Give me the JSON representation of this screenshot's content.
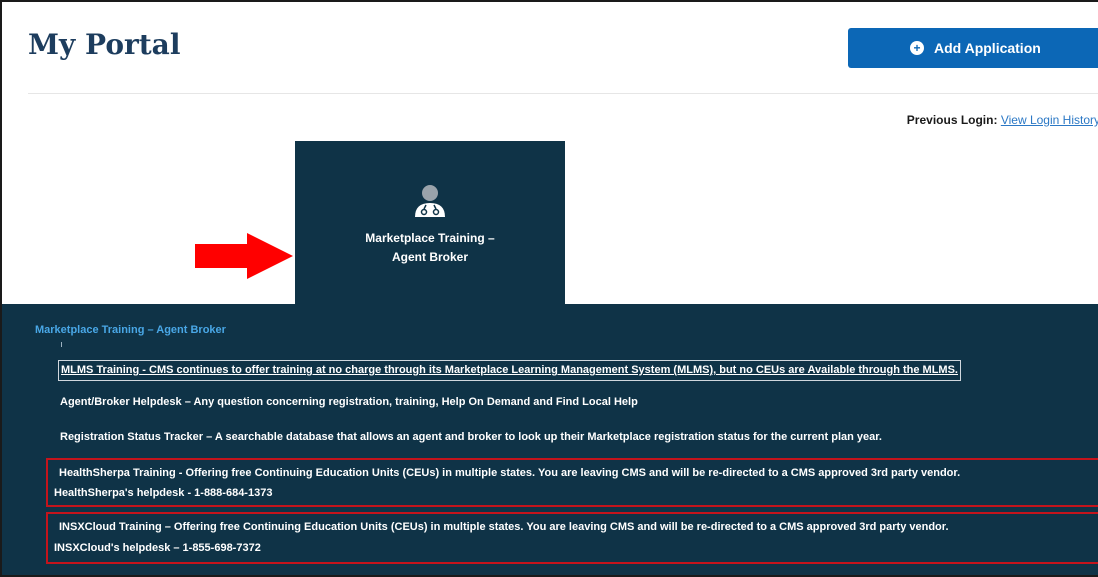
{
  "header": {
    "title": "My Portal",
    "add_button_label": "Add Application"
  },
  "login": {
    "label": "Previous Login:",
    "link_text": "View Login History"
  },
  "tile": {
    "line1": "Marketplace Training –",
    "line2": "Agent Broker",
    "icon": "user-agent-icon"
  },
  "panel": {
    "title": "Marketplace Training – Agent Broker",
    "links": [
      {
        "text": "MLMS Training - CMS continues to offer training at no charge through its Marketplace Learning Management System (MLMS), but no CEUs are Available through the MLMS."
      },
      {
        "text": "Agent/Broker Helpdesk – Any question concerning registration, training, Help On Demand and Find Local Help"
      },
      {
        "text": "Registration Status Tracker – A searchable database that allows an agent and broker to look up their Marketplace registration status for the current plan year."
      }
    ],
    "vendors": [
      {
        "line1": "HealthSherpa Training - Offering free Continuing Education Units (CEUs) in multiple states. You are leaving CMS and will be re-directed to a CMS approved 3rd party vendor.",
        "line2": "HealthSherpa's helpdesk - 1-888-684-1373"
      },
      {
        "line1": "INSXCloud Training – Offering free Continuing Education Units (CEUs) in multiple states. You are leaving CMS and will be re-directed to a CMS approved 3rd party vendor.",
        "line2": "INSXCloud's helpdesk – 1-855-698-7372"
      }
    ]
  },
  "colors": {
    "title": "#1d3d5e",
    "primary_button": "#0c67b6",
    "tile_bg": "#0f3347",
    "panel_title": "#49a7e6",
    "highlight_border": "#c4141c",
    "arrow": "#ff0000"
  }
}
